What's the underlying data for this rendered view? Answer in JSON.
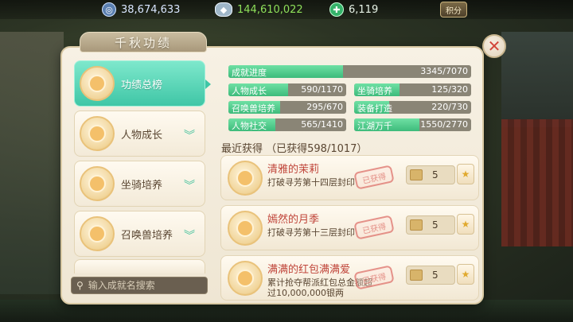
{
  "currency": {
    "gold": "38,674,633",
    "silver": "144,610,022",
    "jade": "6,119",
    "shop_label": "积分"
  },
  "panel": {
    "title": "千秋功绩",
    "close_glyph": "✕"
  },
  "categories": [
    {
      "label": "功绩总榜",
      "active": true
    },
    {
      "label": "人物成长",
      "active": false
    },
    {
      "label": "坐骑培养",
      "active": false
    },
    {
      "label": "召唤兽培养",
      "active": false
    }
  ],
  "search": {
    "placeholder": "输入成就名搜索"
  },
  "progress": {
    "overall": {
      "name": "成就进度",
      "value": "3345/7070",
      "fraction": 0.473
    },
    "items": [
      {
        "name": "人物成长",
        "value": "590/1170",
        "fraction": 0.504
      },
      {
        "name": "坐骑培养",
        "value": "125/320",
        "fraction": 0.391
      },
      {
        "name": "召唤兽培养",
        "value": "295/670",
        "fraction": 0.44
      },
      {
        "name": "装备打造",
        "value": "220/730",
        "fraction": 0.301
      },
      {
        "name": "人物社交",
        "value": "565/1410",
        "fraction": 0.401
      },
      {
        "name": "江湖万千",
        "value": "1550/2770",
        "fraction": 0.56
      }
    ]
  },
  "recent": {
    "label": "最近获得 （已获得598/1017）"
  },
  "achievements": [
    {
      "name": "清雅的茉莉",
      "desc": "打破寻芳第十四层封印",
      "stamp": "已获得",
      "reward": "5"
    },
    {
      "name": "嫣然的月季",
      "desc": "打破寻芳第十三层封印",
      "stamp": "已获得",
      "reward": "5"
    },
    {
      "name": "满满的红包满满爱",
      "desc": "累计抢夺帮派红包总金额超过10,000,000银两",
      "stamp": "已获得",
      "reward": "5"
    }
  ],
  "colors": {
    "accent": "#3fc6a6",
    "progress_fill": "#3dbb7b",
    "title_red": "#c0453a"
  }
}
